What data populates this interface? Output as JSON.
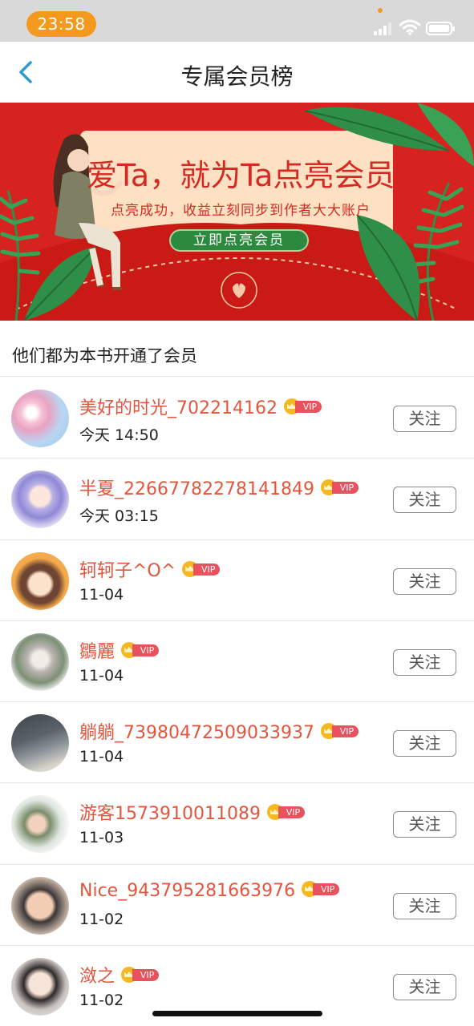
{
  "status_bar": {
    "time": "23:58"
  },
  "nav": {
    "title": "专属会员榜",
    "back_icon": "chevron-left-icon"
  },
  "banner": {
    "headline": "爱Ta，就为Ta点亮会员",
    "subtitle": "点亮成功，收益立刻同步到作者大大账户",
    "cta_label": "立即点亮会员",
    "colors": {
      "background": "#d7231f",
      "card": "#fde1c2",
      "cta": "#2c8a3e"
    }
  },
  "section": {
    "title": "他们都为本书开通了会员"
  },
  "members": [
    {
      "name": "美好的时光_702214162",
      "vip": "VIP",
      "time": "今天 14:50",
      "follow": "关注"
    },
    {
      "name": "半夏_22667782278141849",
      "vip": "VIP",
      "time": "今天 03:15",
      "follow": "关注"
    },
    {
      "name": "轲轲子^O^",
      "vip": "VIP",
      "time": "11-04",
      "follow": "关注"
    },
    {
      "name": "鶵麗",
      "vip": "VIP",
      "time": "11-04",
      "follow": "关注"
    },
    {
      "name": "躺躺_73980472509033937",
      "vip": "VIP",
      "time": "11-04",
      "follow": "关注"
    },
    {
      "name": "游客1573910011089",
      "vip": "VIP",
      "time": "11-03",
      "follow": "关注"
    },
    {
      "name": "Nice_943795281663976",
      "vip": "VIP",
      "time": "11-02",
      "follow": "关注"
    },
    {
      "name": "潋之",
      "vip": "VIP",
      "time": "11-02",
      "follow": "关注"
    }
  ],
  "theme": {
    "name_color": "#e4553d",
    "vip_tag_color": "#e8525c",
    "crown_color": "#f6b820"
  }
}
